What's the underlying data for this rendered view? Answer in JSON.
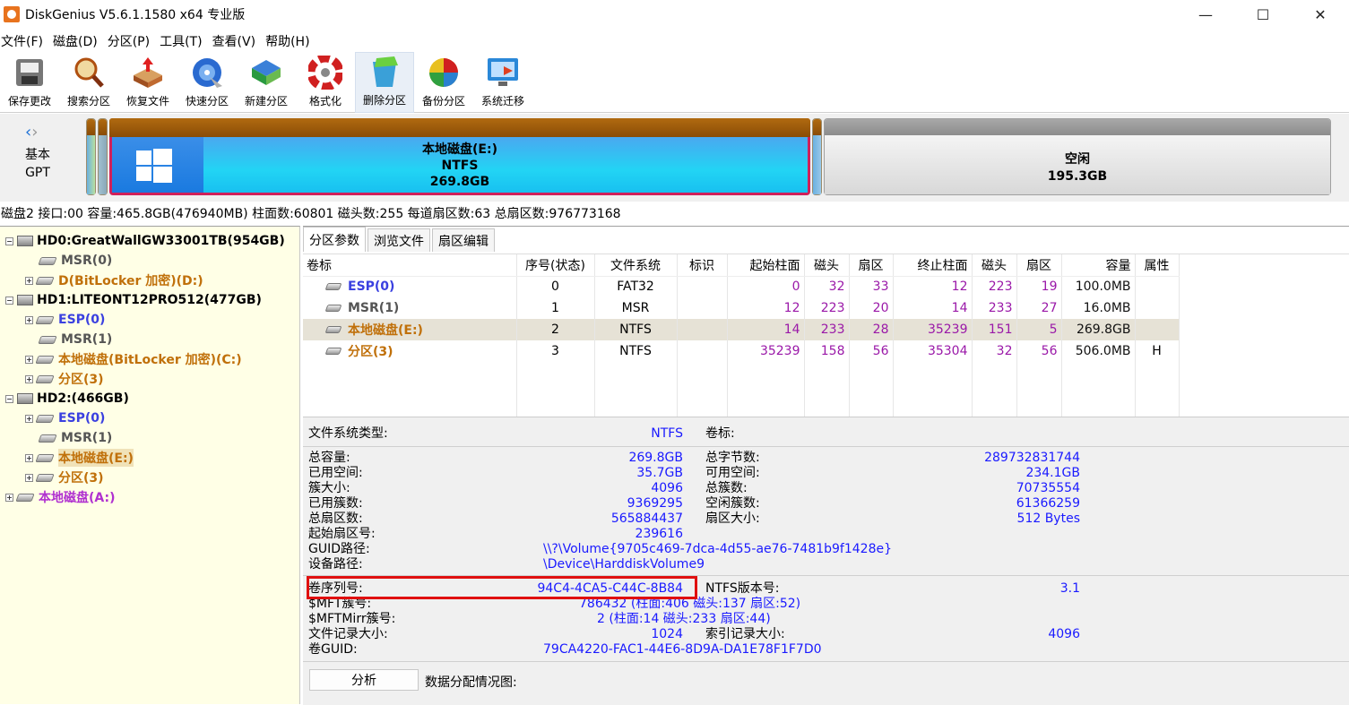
{
  "window": {
    "title": "DiskGenius V5.6.1.1580 x64 专业版"
  },
  "menu": [
    "文件(F)",
    "磁盘(D)",
    "分区(P)",
    "工具(T)",
    "查看(V)",
    "帮助(H)"
  ],
  "toolbar": [
    {
      "label": "保存更改",
      "icon": "save-icon"
    },
    {
      "label": "搜索分区",
      "icon": "search-icon"
    },
    {
      "label": "恢复文件",
      "icon": "recover-icon"
    },
    {
      "label": "快速分区",
      "icon": "quick-partition-icon"
    },
    {
      "label": "新建分区",
      "icon": "new-partition-icon"
    },
    {
      "label": "格式化",
      "icon": "format-icon"
    },
    {
      "label": "删除分区",
      "icon": "delete-partition-icon"
    },
    {
      "label": "备份分区",
      "icon": "backup-partition-icon"
    },
    {
      "label": "系统迁移",
      "icon": "migrate-icon"
    }
  ],
  "diskmap": {
    "type_line1": "基本",
    "type_line2": "GPT",
    "selected": {
      "name": "本地磁盘(E:)",
      "fs": "NTFS",
      "size": "269.8GB"
    },
    "free": {
      "name": "空闲",
      "size": "195.3GB"
    }
  },
  "diskinfo": "磁盘2 接口:00  容量:465.8GB(476940MB)  柱面数:60801  磁头数:255  每道扇区数:63  总扇区数:976773168",
  "tree": {
    "hd0": "HD0:GreatWallGW33001TB(954GB)",
    "hd0_msr": "MSR(0)",
    "hd0_d": "D(BitLocker 加密)(D:)",
    "hd1": "HD1:LITEONT12PRO512(477GB)",
    "hd1_esp": "ESP(0)",
    "hd1_msr": "MSR(1)",
    "hd1_c": "本地磁盘(BitLocker 加密)(C:)",
    "hd1_p3": "分区(3)",
    "hd2": "HD2:(466GB)",
    "hd2_esp": "ESP(0)",
    "hd2_msr": "MSR(1)",
    "hd2_e": "本地磁盘(E:)",
    "hd2_p3": "分区(3)",
    "a": "本地磁盘(A:)"
  },
  "tabs": [
    "分区参数",
    "浏览文件",
    "扇区编辑"
  ],
  "table": {
    "headers": [
      "卷标",
      "序号(状态)",
      "文件系统",
      "标识",
      "起始柱面",
      "磁头",
      "扇区",
      "终止柱面",
      "磁头",
      "扇区",
      "容量",
      "属性"
    ],
    "rows": [
      {
        "name": "ESP(0)",
        "idx": "0",
        "fs": "FAT32",
        "flag": "",
        "sc": "0",
        "sh": "32",
        "ss": "33",
        "ec": "12",
        "eh": "223",
        "es": "19",
        "cap": "100.0MB",
        "attr": ""
      },
      {
        "name": "MSR(1)",
        "idx": "1",
        "fs": "MSR",
        "flag": "",
        "sc": "12",
        "sh": "223",
        "ss": "20",
        "ec": "14",
        "eh": "233",
        "es": "27",
        "cap": "16.0MB",
        "attr": ""
      },
      {
        "name": "本地磁盘(E:)",
        "idx": "2",
        "fs": "NTFS",
        "flag": "",
        "sc": "14",
        "sh": "233",
        "ss": "28",
        "ec": "35239",
        "eh": "151",
        "es": "5",
        "cap": "269.8GB",
        "attr": ""
      },
      {
        "name": "分区(3)",
        "idx": "3",
        "fs": "NTFS",
        "flag": "",
        "sc": "35239",
        "sh": "158",
        "ss": "56",
        "ec": "35304",
        "eh": "32",
        "es": "56",
        "cap": "506.0MB",
        "attr": "H"
      }
    ]
  },
  "details": {
    "fs_type_label": "文件系统类型:",
    "fs_type": "NTFS",
    "vol_label_label": "卷标:",
    "total_cap_label": "总容量:",
    "total_cap": "269.8GB",
    "total_bytes_label": "总字节数:",
    "total_bytes": "289732831744",
    "used_label": "已用空间:",
    "used": "35.7GB",
    "free_label": "可用空间:",
    "free": "234.1GB",
    "cluster_label": "簇大小:",
    "cluster": "4096",
    "total_clusters_label": "总簇数:",
    "total_clusters": "70735554",
    "used_clusters_label": "已用簇数:",
    "used_clusters": "9369295",
    "free_clusters_label": "空闲簇数:",
    "free_clusters": "61366259",
    "total_sectors_label": "总扇区数:",
    "total_sectors": "565884437",
    "sector_size_label": "扇区大小:",
    "sector_size": "512 Bytes",
    "start_sector_label": "起始扇区号:",
    "start_sector": "239616",
    "guid_path_label": "GUID路径:",
    "guid_path": "\\\\?\\Volume{9705c469-7dca-4d55-ae76-7481b9f1428e}",
    "device_path_label": "设备路径:",
    "device_path": "\\Device\\HarddiskVolume9",
    "serial_label": "卷序列号:",
    "serial": "94C4-4CA5-C44C-8B84",
    "ntfs_ver_label": "NTFS版本号:",
    "ntfs_ver": "3.1",
    "mft_label": "$MFT簇号:",
    "mft": "786432 (柱面:406 磁头:137 扇区:52)",
    "mftmirr_label": "$MFTMirr簇号:",
    "mftmirr": "2 (柱面:14 磁头:233 扇区:44)",
    "file_rec_label": "文件记录大小:",
    "file_rec": "1024",
    "index_rec_label": "索引记录大小:",
    "index_rec": "4096",
    "vol_guid_label": "卷GUID:",
    "vol_guid": "79CA4220-FAC1-44E6-8D9A-DA1E78F1F7D0",
    "analyze_button": "分析",
    "alloc_label": "数据分配情况图:"
  }
}
